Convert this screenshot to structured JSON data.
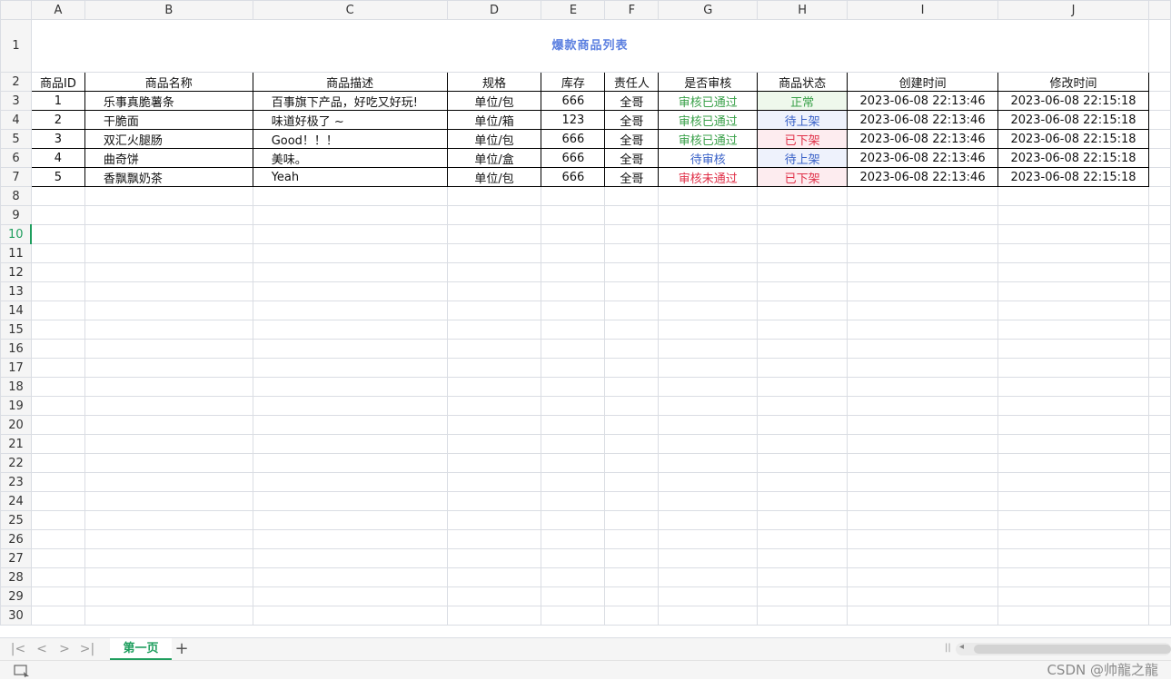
{
  "columns": [
    "A",
    "B",
    "C",
    "D",
    "E",
    "F",
    "G",
    "H",
    "I",
    "J"
  ],
  "title": "爆款商品列表",
  "headers": [
    "商品ID",
    "商品名称",
    "商品描述",
    "规格",
    "库存",
    "责任人",
    "是否审核",
    "商品状态",
    "创建时间",
    "修改时间"
  ],
  "rows": [
    {
      "id": "1",
      "name": "乐事真脆薯条",
      "desc": "百事旗下产品，好吃又好玩!",
      "spec": "单位/包",
      "stock": "666",
      "owner": "全哥",
      "audit": "审核已通过",
      "audit_color": "#3aa14a",
      "status": "正常",
      "status_color": "#3aa14a",
      "status_bg": "#eef8ec",
      "created": "2023-06-08 22:13:46",
      "modified": "2023-06-08 22:15:18"
    },
    {
      "id": "2",
      "name": "干脆面",
      "desc": "味道好极了 ~",
      "spec": "单位/箱",
      "stock": "123",
      "owner": "全哥",
      "audit": "审核已通过",
      "audit_color": "#3aa14a",
      "status": "待上架",
      "status_color": "#3a62c8",
      "status_bg": "#eef2fc",
      "created": "2023-06-08 22:13:46",
      "modified": "2023-06-08 22:15:18"
    },
    {
      "id": "3",
      "name": "双汇火腿肠",
      "desc": "Good！！！",
      "spec": "单位/包",
      "stock": "666",
      "owner": "全哥",
      "audit": "审核已通过",
      "audit_color": "#3aa14a",
      "status": "已下架",
      "status_color": "#e03048",
      "status_bg": "#fdecef",
      "created": "2023-06-08 22:13:46",
      "modified": "2023-06-08 22:15:18"
    },
    {
      "id": "4",
      "name": "曲奇饼",
      "desc": "美味。",
      "spec": "单位/盒",
      "stock": "666",
      "owner": "全哥",
      "audit": "待审核",
      "audit_color": "#3a62c8",
      "status": "待上架",
      "status_color": "#3a62c8",
      "status_bg": "#eef2fc",
      "created": "2023-06-08 22:13:46",
      "modified": "2023-06-08 22:15:18"
    },
    {
      "id": "5",
      "name": "香飘飘奶茶",
      "desc": "Yeah",
      "spec": "单位/包",
      "stock": "666",
      "owner": "全哥",
      "audit": "审核未通过",
      "audit_color": "#e03048",
      "status": "已下架",
      "status_color": "#e03048",
      "status_bg": "#fdecef",
      "created": "2023-06-08 22:13:46",
      "modified": "2023-06-08 22:15:18"
    }
  ],
  "row_numbers": [
    "1",
    "2",
    "3",
    "4",
    "5",
    "6",
    "7",
    "8",
    "9",
    "10",
    "11",
    "12",
    "13",
    "14",
    "15",
    "16",
    "17",
    "18",
    "19",
    "20",
    "21",
    "22",
    "23",
    "24",
    "25",
    "26",
    "27",
    "28",
    "29",
    "30"
  ],
  "active_row": "10",
  "sheet_tabs": [
    {
      "label": "第一页",
      "active": true
    }
  ],
  "nav_icons": [
    "first-sheet-icon",
    "prev-sheet-icon",
    "next-sheet-icon",
    "last-sheet-icon"
  ],
  "watermark": "CSDN @帅龍之龍"
}
